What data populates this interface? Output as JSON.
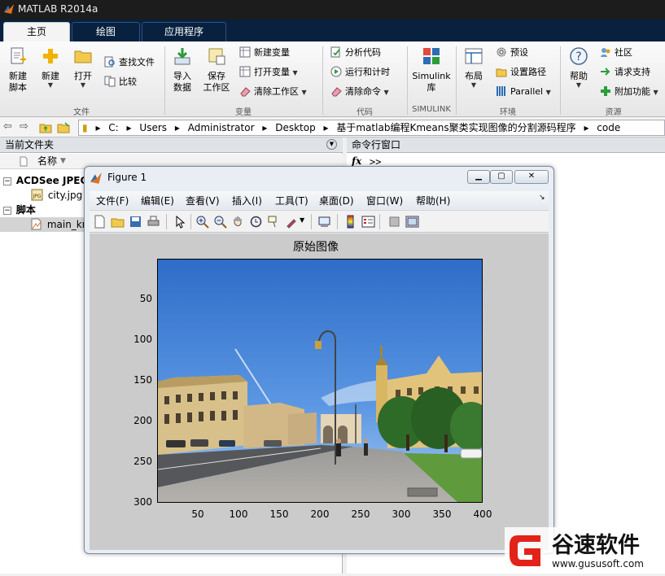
{
  "window": {
    "title": "MATLAB R2014a"
  },
  "tabs": [
    {
      "label": "主页"
    },
    {
      "label": "绘图"
    },
    {
      "label": "应用程序"
    }
  ],
  "ribbon": {
    "file": {
      "new_script": "新建\n脚本",
      "new": "新建",
      "open": "打开",
      "find_files": "查找文件",
      "compare": "比较",
      "group": "文件"
    },
    "variable": {
      "import": "导入\n数据",
      "save_ws": "保存\n工作区",
      "new_var": "新建变量",
      "open_var": "打开变量",
      "clear_ws": "清除工作区",
      "group": "变量"
    },
    "code": {
      "analyze": "分析代码",
      "run_time": "运行和计时",
      "clear_cmd": "清除命令",
      "group": "代码"
    },
    "simulink": {
      "label": "Simulink\n库",
      "group": "SIMULINK"
    },
    "env": {
      "layout": "布局",
      "prefs": "预设",
      "set_path": "设置路径",
      "parallel": "Parallel",
      "group": "环境"
    },
    "resources": {
      "help": "帮助",
      "community": "社区",
      "support": "请求支持",
      "addons": "附加功能",
      "group": "资源"
    }
  },
  "address": {
    "crumbs": [
      "C:",
      "Users",
      "Administrator",
      "Desktop",
      "基于matlab编程Kmeans聚类实现图像的分割源码程序",
      "code"
    ]
  },
  "left_panel": {
    "title": "当前文件夹",
    "col_name": "名称",
    "group1": "ACDSee JPEG",
    "file1": "city.jpg",
    "group2": "脚本",
    "file2": "main_km"
  },
  "right_panel": {
    "title": "命令行窗口",
    "prompt": ">>",
    "fx": "fx"
  },
  "figure": {
    "title": "Figure 1",
    "menus": [
      "文件(F)",
      "编辑(E)",
      "查看(V)",
      "插入(I)",
      "工具(T)",
      "桌面(D)",
      "窗口(W)",
      "帮助(H)"
    ],
    "axes_title": "原始图像",
    "yticks": [
      "50",
      "100",
      "150",
      "200",
      "250",
      "300"
    ],
    "xticks": [
      "50",
      "100",
      "150",
      "200",
      "250",
      "300",
      "350",
      "400"
    ]
  },
  "watermark": {
    "name": "谷速软件",
    "url": "www.gususoft.com"
  },
  "colors": {
    "accent": "#08213f",
    "titlebar": "#1c1c1c",
    "sky": "#3d7fd6"
  }
}
